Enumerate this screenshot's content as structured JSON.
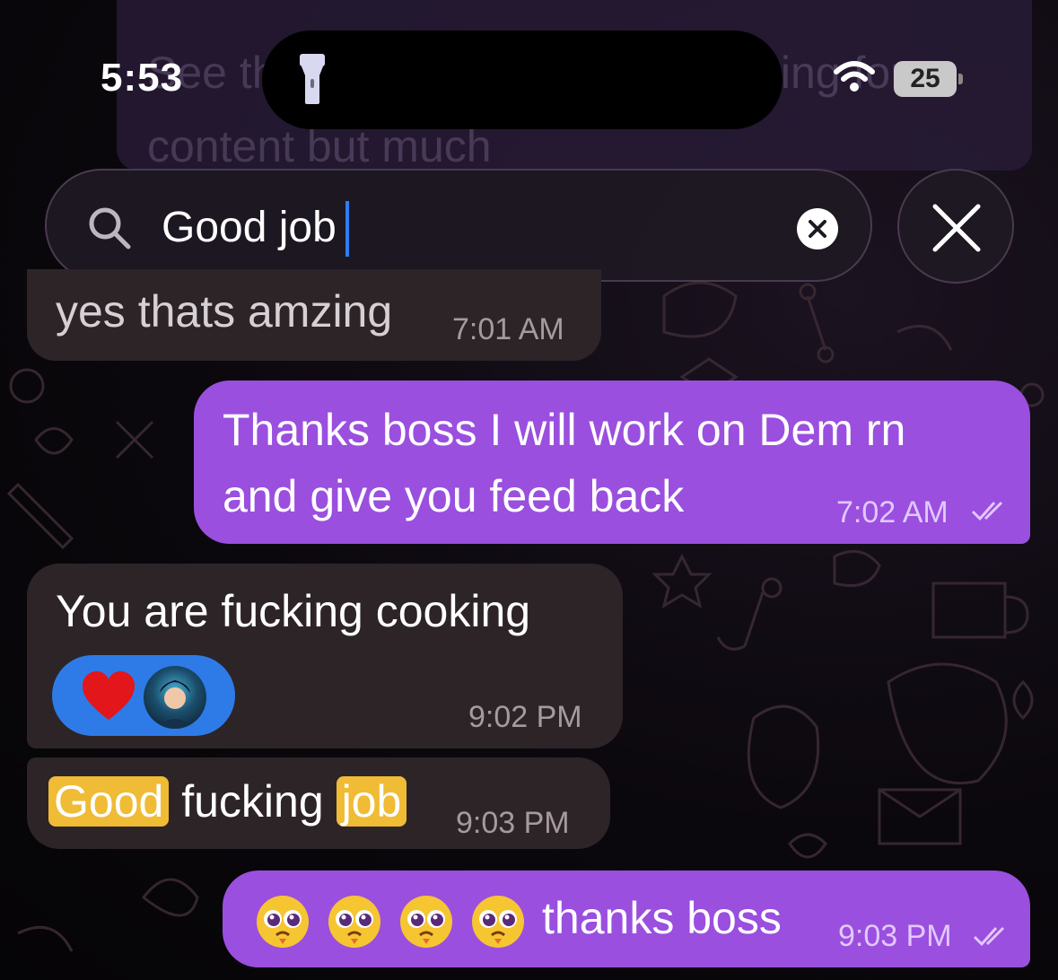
{
  "status_bar": {
    "time": "5:53",
    "battery": "25"
  },
  "faded_message": {
    "text": "See the ... the first way I was using for content but much"
  },
  "search": {
    "query": "Good job"
  },
  "messages": [
    {
      "id": "m1",
      "direction": "incoming",
      "text": "yes thats amzing",
      "time": "7:01 AM"
    },
    {
      "id": "m2",
      "direction": "outgoing",
      "line1": "Thanks boss I will work on Dem rn",
      "line2": "and give you feed back",
      "time": "7:02 AM",
      "read": true
    },
    {
      "id": "m3",
      "direction": "incoming",
      "text": "You are fucking cooking",
      "time": "9:02 PM",
      "reactions": [
        "heart",
        "avatar"
      ]
    },
    {
      "id": "m4",
      "direction": "incoming",
      "parts": [
        "Good",
        "fucking",
        "job"
      ],
      "highlighted": [
        "Good",
        "job"
      ],
      "time": "9:03 PM"
    },
    {
      "id": "m5",
      "direction": "outgoing",
      "emoji_count": 4,
      "text": "thanks boss",
      "time": "9:03 PM",
      "read": true
    }
  ],
  "colors": {
    "outgoing": "#9a4fdf",
    "incoming": "#2d2428",
    "highlight": "#f0bb35",
    "reaction": "#2e7be7"
  }
}
